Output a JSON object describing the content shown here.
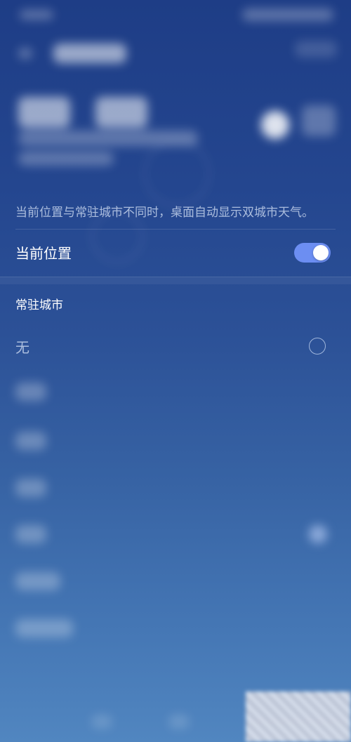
{
  "settings": {
    "tip": "当前位置与常驻城市不同时，桌面自动显示双城市天气。",
    "current_location": {
      "label": "当前位置",
      "enabled": true
    },
    "resident_city": {
      "header": "常驻城市",
      "options": [
        {
          "label": "无",
          "selected": false
        }
      ]
    }
  },
  "colors": {
    "toggle_on": "#6c8ef2",
    "background_top": "#1e3d86",
    "background_bottom": "#5186c0"
  },
  "icons": {
    "toggle": "toggle-switch-on",
    "radio": "radio-unselected"
  }
}
